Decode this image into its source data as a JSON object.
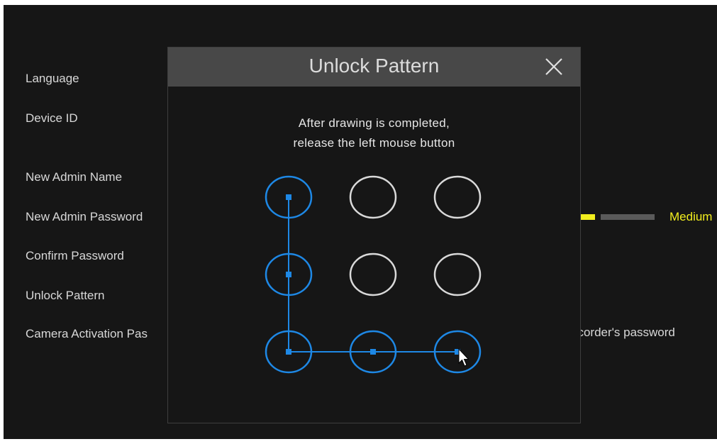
{
  "settings_form": {
    "labels": {
      "language": "Language",
      "device_id": "Device ID",
      "new_admin_name": "New Admin Name",
      "new_admin_password": "New Admin Password",
      "confirm_password": "Confirm Password",
      "unlock_pattern": "Unlock Pattern",
      "camera_activation": "Camera Activation Pas"
    },
    "password_strength": {
      "label": "Medium",
      "color": "#f2ee1e"
    },
    "recorder_note": "ecorder's password"
  },
  "dialog": {
    "title": "Unlock Pattern",
    "close_icon": "close-icon",
    "instruction_line1": "After drawing is completed,",
    "instruction_line2": "release the left mouse button"
  },
  "pattern": {
    "grid": "3x3",
    "selected_dots": [
      1,
      4,
      7,
      8,
      9
    ],
    "active_color": "#1e88e5",
    "inactive_color": "#d9d9d9"
  },
  "cursor_icon": "mouse-pointer-icon"
}
